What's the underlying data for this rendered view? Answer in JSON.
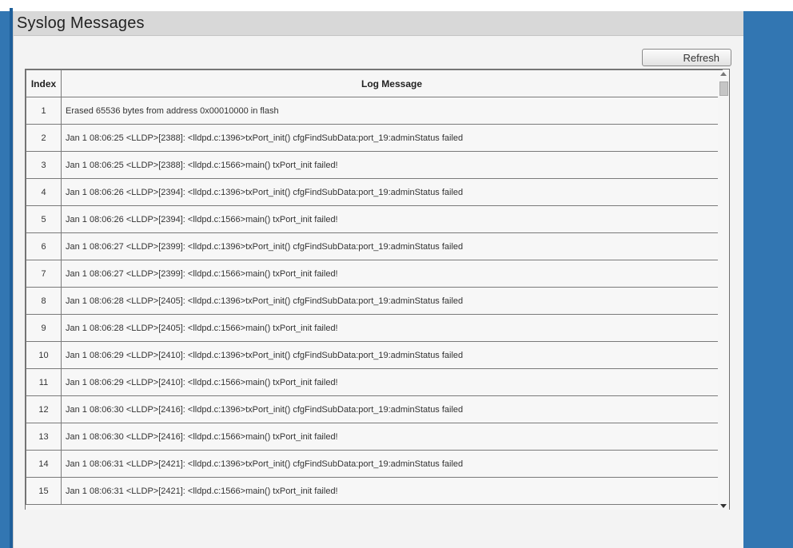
{
  "panel": {
    "title": "Syslog Messages",
    "refresh_label": "Refresh"
  },
  "table": {
    "headers": [
      "Index",
      "Log Message"
    ],
    "rows": [
      {
        "index": "1",
        "message": "Erased 65536 bytes from address 0x00010000 in flash"
      },
      {
        "index": "2",
        "message": "Jan  1 08:06:25 <LLDP>[2388]: <lldpd.c:1396>txPort_init() cfgFindSubData:port_19:adminStatus failed"
      },
      {
        "index": "3",
        "message": "Jan  1 08:06:25 <LLDP>[2388]: <lldpd.c:1566>main() txPort_init failed!"
      },
      {
        "index": "4",
        "message": "Jan  1 08:06:26 <LLDP>[2394]: <lldpd.c:1396>txPort_init() cfgFindSubData:port_19:adminStatus failed"
      },
      {
        "index": "5",
        "message": "Jan  1 08:06:26 <LLDP>[2394]: <lldpd.c:1566>main() txPort_init failed!"
      },
      {
        "index": "6",
        "message": "Jan  1 08:06:27 <LLDP>[2399]: <lldpd.c:1396>txPort_init() cfgFindSubData:port_19:adminStatus failed"
      },
      {
        "index": "7",
        "message": "Jan  1 08:06:27 <LLDP>[2399]: <lldpd.c:1566>main() txPort_init failed!"
      },
      {
        "index": "8",
        "message": "Jan  1 08:06:28 <LLDP>[2405]: <lldpd.c:1396>txPort_init() cfgFindSubData:port_19:adminStatus failed"
      },
      {
        "index": "9",
        "message": "Jan  1 08:06:28 <LLDP>[2405]: <lldpd.c:1566>main() txPort_init failed!"
      },
      {
        "index": "10",
        "message": "Jan  1 08:06:29 <LLDP>[2410]: <lldpd.c:1396>txPort_init() cfgFindSubData:port_19:adminStatus failed"
      },
      {
        "index": "11",
        "message": "Jan  1 08:06:29 <LLDP>[2410]: <lldpd.c:1566>main() txPort_init failed!"
      },
      {
        "index": "12",
        "message": "Jan  1 08:06:30 <LLDP>[2416]: <lldpd.c:1396>txPort_init() cfgFindSubData:port_19:adminStatus failed"
      },
      {
        "index": "13",
        "message": "Jan  1 08:06:30 <LLDP>[2416]: <lldpd.c:1566>main() txPort_init failed!"
      },
      {
        "index": "14",
        "message": "Jan  1 08:06:31 <LLDP>[2421]: <lldpd.c:1396>txPort_init() cfgFindSubData:port_19:adminStatus failed"
      },
      {
        "index": "15",
        "message": "Jan  1 08:06:31 <LLDP>[2421]: <lldpd.c:1566>main() txPort_init failed!"
      }
    ]
  },
  "colors": {
    "background": "#3276b2",
    "panel": "#f3f3f3",
    "header_bar": "#d8d8d8"
  },
  "icons": {
    "scroll_up": "scroll-up-arrow-icon",
    "scroll_down": "scroll-down-arrow-icon"
  }
}
